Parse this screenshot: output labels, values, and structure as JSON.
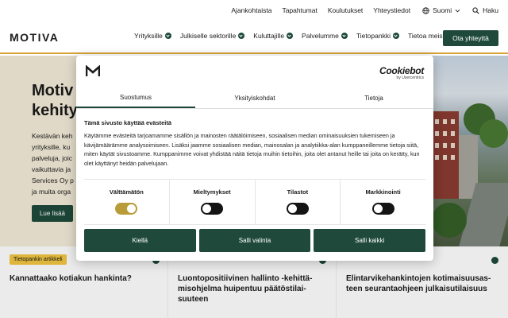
{
  "utility_nav": {
    "links": [
      "Ajankohtaista",
      "Tapahtumat",
      "Koulutukset",
      "Yhteystiedot"
    ],
    "language": "Suomi",
    "search": "Haku"
  },
  "header": {
    "logo": "MOTIVA",
    "nav": [
      "Yrityksille",
      "Julkiselle sektorille",
      "Kuluttajille",
      "Palvelumme",
      "Tietopankki",
      "Tietoa meistä"
    ],
    "contact_button": "Ota yhteyttä"
  },
  "hero": {
    "title": "Motiv\nkehity",
    "text": "Kestävän keh\nyrityksille, ku\npalveluja, joic\nvaikuttavia ja\nServices Oy p\nja muita orga",
    "button": "Lue lisää"
  },
  "cards": [
    {
      "tag": "Tietopankin artikkeli",
      "title": "Kannattaako kotiakun hankinta?"
    },
    {
      "tag": "",
      "title": "Luontopositiivinen hallinto -kehittä-\nmisohjelma huipentuu päätöstilai-\nsuuteen"
    },
    {
      "tag": "",
      "title": "Elintarvikehankintojen kotimaisuusas-\nteen seurantaohjeen julkaisutilaisuus"
    }
  ],
  "consent": {
    "brand": "Cookiebot",
    "brand_sub": "by Usercentrics",
    "tabs": [
      "Suostumus",
      "Yksityiskohdat",
      "Tietoja"
    ],
    "active_tab": 0,
    "heading": "Tämä sivusto käyttää evästeitä",
    "body": "Käytämme evästeitä tarjoamamme sisällön ja mainosten räätälöimiseen, sosiaalisen median ominaisuuksien tukemiseen ja kävijämäärämme analysoimiseen. Lisäksi jaamme sosiaalisen median, mainosalan ja analytiikka-alan kumppaneillemme tietoja siitä, miten käytät sivustoamme. Kumppanimme voivat yhdistää näitä tietoja muihin tietoihin, joita olet antanut heille tai joita on kerätty, kun olet käyttänyt heidän palvelujaan.",
    "switches": [
      {
        "label": "Välttämätön",
        "on": true
      },
      {
        "label": "Mieltymykset",
        "on": false
      },
      {
        "label": "Tilastot",
        "on": false
      },
      {
        "label": "Markkinointi",
        "on": false
      }
    ],
    "buttons": [
      "Kiellä",
      "Salli valinta",
      "Salli kaikki"
    ]
  },
  "colors": {
    "accent": "#1f4a3b",
    "gold": "#d7a53a",
    "toggle_on": "#b99b38"
  }
}
